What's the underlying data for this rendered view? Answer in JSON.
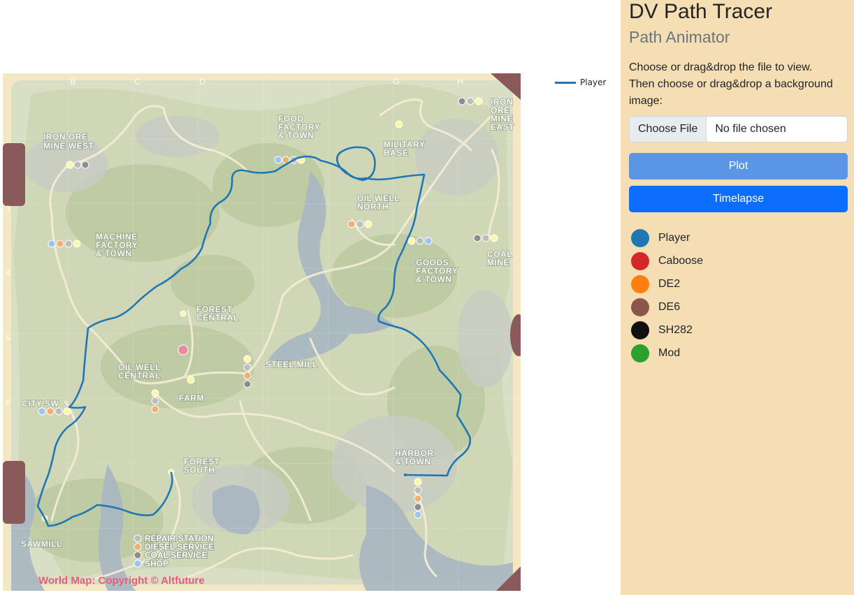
{
  "panel": {
    "title": "DV Path Tracer",
    "subtitle": "Path Animator",
    "instructions_line1": "Choose or drag&drop the file to view.",
    "instructions_line2": "Then choose or drag&drop a background image:",
    "file_button": "Choose File",
    "file_status": "No file chosen",
    "plot_button": "Plot",
    "timelapse_button": "Timelapse",
    "legend": [
      {
        "label": "Player",
        "color": "#1f77b4"
      },
      {
        "label": "Caboose",
        "color": "#d62728"
      },
      {
        "label": "DE2",
        "color": "#ff7f0e"
      },
      {
        "label": "DE6",
        "color": "#8c564b"
      },
      {
        "label": "SH282",
        "color": "#111111"
      },
      {
        "label": "Mod",
        "color": "#2ca02c"
      }
    ]
  },
  "plot_legend": {
    "series_label": "Player",
    "color": "#1f77b4"
  },
  "map": {
    "columns": [
      "B",
      "C",
      "D",
      "G",
      "H"
    ],
    "rows": [
      "3",
      "4",
      "5",
      "6"
    ],
    "places": {
      "iron_ore_west": [
        "IRON ORE",
        "MINE WEST"
      ],
      "food_factory": [
        "FOOD",
        "FACTORY",
        "& TOWN"
      ],
      "military_base": [
        "MILITARY",
        "BASE"
      ],
      "iron_ore_east": [
        "IRON",
        "ORE",
        "MINE",
        "EAST"
      ],
      "oil_well_north": [
        "OIL WELL",
        "NORTH"
      ],
      "machine_factory": [
        "MACHINE",
        "FACTORY",
        "& TOWN"
      ],
      "goods_factory": [
        "GOODS",
        "FACTORY",
        "& TOWN"
      ],
      "coal_mine": [
        "COAL",
        "MINE"
      ],
      "forest_central": [
        "FOREST",
        "CENTRAL"
      ],
      "oil_well_central": [
        "OIL WELL",
        "CENTRAL"
      ],
      "steel_mill": [
        "STEEL MILL"
      ],
      "city_sw": [
        "CITY SW"
      ],
      "farm": [
        "FARM"
      ],
      "forest_south": [
        "FOREST",
        "SOUTH"
      ],
      "harbor": [
        "HARBOR",
        "& TOWN"
      ],
      "sawmill": [
        "SAWMILL"
      ]
    },
    "map_legend": [
      "REPAIR STATION",
      "DIESEL SERVICE",
      "COAL SERVICE",
      "SHOP"
    ],
    "copyright": "World Map: Copyright © Altfuture",
    "service_colors": {
      "repair": "#bdbdbd",
      "diesel": "#f0b070",
      "coal": "#8d8d8d",
      "shop": "#9cc4f0",
      "station": "#fdf7a8"
    }
  }
}
